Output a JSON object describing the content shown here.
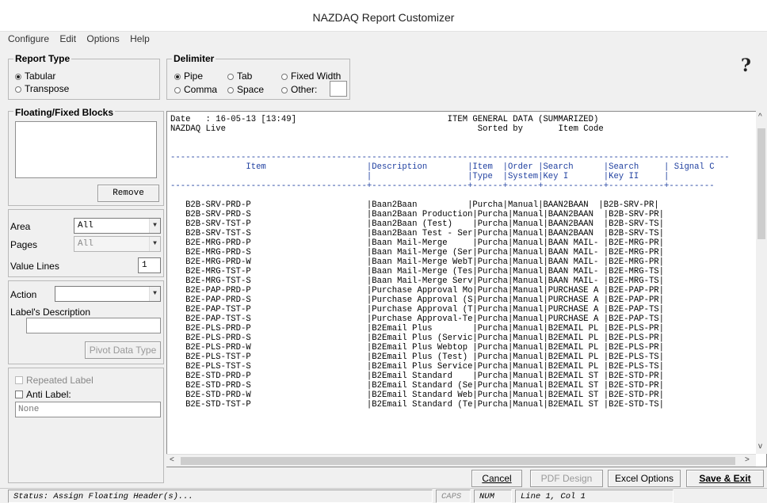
{
  "window": {
    "title": "NAZDAQ Report Customizer"
  },
  "menu": [
    "Configure",
    "Edit",
    "Options",
    "Help"
  ],
  "report_type": {
    "legend": "Report Type",
    "options": [
      {
        "label": "Tabular",
        "selected": true
      },
      {
        "label": "Transpose",
        "selected": false
      }
    ]
  },
  "delimiter": {
    "legend": "Delimiter",
    "options": [
      {
        "label": "Pipe",
        "selected": true
      },
      {
        "label": "Tab",
        "selected": false
      },
      {
        "label": "Fixed Width",
        "selected": false
      },
      {
        "label": "Comma",
        "selected": false
      },
      {
        "label": "Space",
        "selected": false
      },
      {
        "label": "Other:",
        "selected": false
      }
    ],
    "other_value": ""
  },
  "help_icon": "question-mark-icon",
  "floating": {
    "legend": "Floating/Fixed Blocks",
    "remove_label": "Remove"
  },
  "settings": {
    "area_label": "Area",
    "area_value": "All",
    "pages_label": "Pages",
    "pages_value": "All",
    "value_lines_label": "Value Lines",
    "value_lines_value": "1"
  },
  "action": {
    "action_label": "Action",
    "action_value": "",
    "desc_label": "Label's Description",
    "desc_value": "",
    "pivot_label": "Pivot Data Type"
  },
  "labels": {
    "repeated_label": "Repeated Label",
    "anti_label": "Anti Label:",
    "anti_value": "None"
  },
  "report": {
    "header_lines": [
      "Date   : 16-05-13 [13:49]                              ITEM GENERAL DATA (SUMMARIZED)",
      "NAZDAQ Live                                                  Sorted by       Item Code"
    ],
    "separator": "---------------------------------------------------------------------------------------------------------------",
    "column_lines": [
      "               Item                    |Description        |Item  |Order |Search      |Search     | Signal C",
      "                                       |                   |Type  |System|Key I       |Key II     |",
      "---------------------------------------+-------------------+------+------+------------+-----------+---------"
    ],
    "rows": [
      "   B2B-SRV-PRD-P                       |Baan2Baan          |Purcha|Manual|BAAN2BAAN  |B2B-SRV-PR|",
      "   B2B-SRV-PRD-S                       |Baan2Baan Production|Purcha|Manual|BAAN2BAAN  |B2B-SRV-PR|",
      "   B2B-SRV-TST-P                       |Baan2Baan (Test)    |Purcha|Manual|BAAN2BAAN  |B2B-SRV-TS|",
      "   B2B-SRV-TST-S                       |Baan2Baan Test - Ser|Purcha|Manual|BAAN2BAAN  |B2B-SRV-TS|",
      "   B2E-MRG-PRD-P                       |Baan Mail-Merge     |Purcha|Manual|BAAN MAIL- |B2E-MRG-PR|",
      "   B2E-MRG-PRD-S                       |Baan Mail-Merge (Ser|Purcha|Manual|BAAN MAIL- |B2E-MRG-PR|",
      "   B2E-MRG-PRD-W                       |Baan Mail-Merge WebT|Purcha|Manual|BAAN MAIL- |B2E-MRG-PR|",
      "   B2E-MRG-TST-P                       |Baan Mail-Merge (Tes|Purcha|Manual|BAAN MAIL- |B2E-MRG-TS|",
      "   B2E-MRG-TST-S                       |Baan Mail-Merge Serv|Purcha|Manual|BAAN MAIL- |B2E-MRG-TS|",
      "   B2E-PAP-PRD-P                       |Purchase Approval Mo|Purcha|Manual|PURCHASE A |B2E-PAP-PR|",
      "   B2E-PAP-PRD-S                       |Purchase Approval (S|Purcha|Manual|PURCHASE A |B2E-PAP-PR|",
      "   B2E-PAP-TST-P                       |Purchase Approval (T|Purcha|Manual|PURCHASE A |B2E-PAP-TS|",
      "   B2E-PAP-TST-S                       |Purchase Approval-Te|Purcha|Manual|PURCHASE A |B2E-PAP-TS|",
      "   B2E-PLS-PRD-P                       |B2Email Plus        |Purcha|Manual|B2EMAIL PL |B2E-PLS-PR|",
      "   B2E-PLS-PRD-S                       |B2Email Plus (Servic|Purcha|Manual|B2EMAIL PL |B2E-PLS-PR|",
      "   B2E-PLS-PRD-W                       |B2Email Plus Webtop |Purcha|Manual|B2EMAIL PL |B2E-PLS-PR|",
      "   B2E-PLS-TST-P                       |B2Email Plus (Test) |Purcha|Manual|B2EMAIL PL |B2E-PLS-TS|",
      "   B2E-PLS-TST-S                       |B2Email Plus Service|Purcha|Manual|B2EMAIL PL |B2E-PLS-TS|",
      "   B2E-STD-PRD-P                       |B2Email Standard    |Purcha|Manual|B2EMAIL ST |B2E-STD-PR|",
      "   B2E-STD-PRD-S                       |B2Email Standard (Se|Purcha|Manual|B2EMAIL ST |B2E-STD-PR|",
      "   B2E-STD-PRD-W                       |B2Email Standard Web|Purcha|Manual|B2EMAIL ST |B2E-STD-PR|",
      "   B2E-STD-TST-P                       |B2Email Standard (Te|Purcha|Manual|B2EMAIL ST |B2E-STD-TS|"
    ]
  },
  "buttons": {
    "cancel": "Cancel",
    "pdf_design": "PDF Design",
    "excel_options": "Excel Options",
    "save_exit": "Save & Exit"
  },
  "status": {
    "message": "Status: Assign Floating Header(s)...",
    "caps": "CAPS",
    "num": "NUM",
    "position": "Line 1, Col 1"
  }
}
